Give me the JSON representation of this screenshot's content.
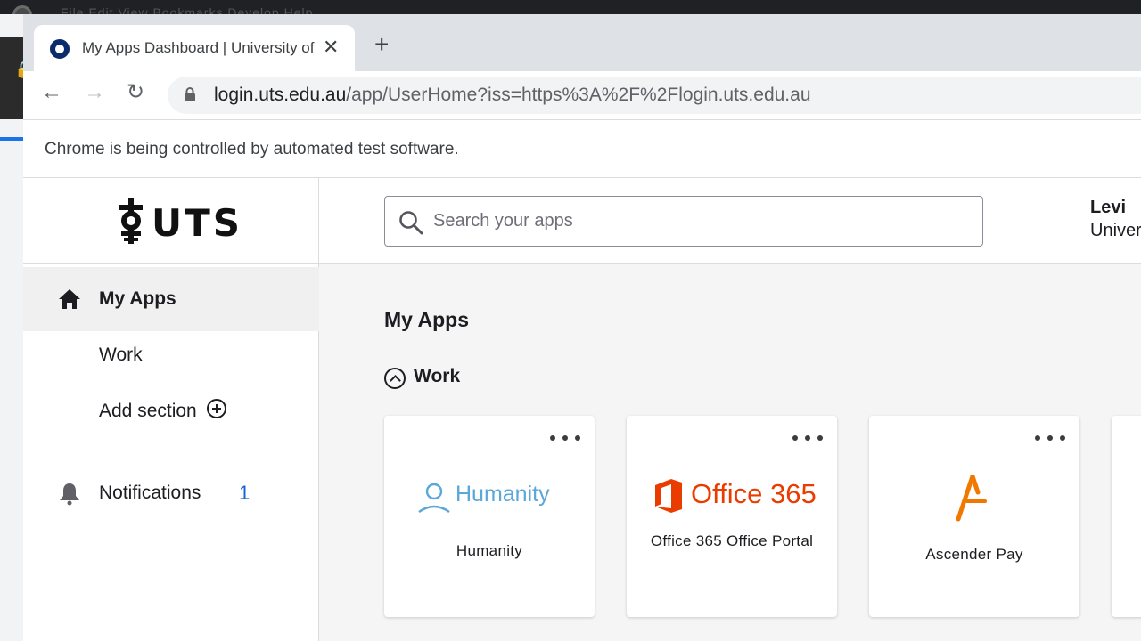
{
  "os": {
    "menu_text": "File   Edit   View   Bookmarks   Develop   Help"
  },
  "browser": {
    "tab_title": "My Apps Dashboard | University of Technology Sydney",
    "url_domain": "login.uts.edu.au",
    "url_path": "/app/UserHome?iss=https%3A%2F%2Flogin.uts.edu.au",
    "infobar_text": "Chrome is being controlled by automated test software."
  },
  "sidebar": {
    "logo_text": "UTS",
    "items": [
      {
        "label": "My Apps",
        "icon": "home-icon"
      },
      {
        "label": "Work"
      },
      {
        "label": "Add section",
        "icon": "plus-circle-icon"
      },
      {
        "label": "Notifications",
        "icon": "bell-icon",
        "count": "1"
      }
    ]
  },
  "header": {
    "search_placeholder": "Search your apps",
    "user_name": "Levi",
    "user_org": "University of Technology Sydney"
  },
  "main": {
    "title": "My Apps",
    "section": "Work",
    "apps": [
      {
        "name": "Humanity",
        "logo_text": "Humanity",
        "logo_color": "#5aa7d8"
      },
      {
        "name": "Office 365 Office Portal",
        "logo_text": "Office 365",
        "logo_color": "#eb3c00"
      },
      {
        "name": "Ascender Pay",
        "logo_color": "#f07800"
      }
    ]
  },
  "colors": {
    "accent": "#1662dd",
    "brand": "#0b2c6b"
  }
}
